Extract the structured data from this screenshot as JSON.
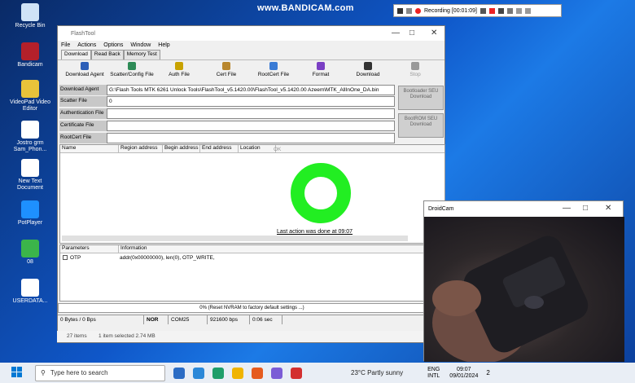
{
  "banner": "www.BANDICAM.com",
  "recorder": {
    "status": "Recording [00:01:09]"
  },
  "desktop_icons": [
    {
      "label": "Recycle Bin",
      "icon": "recycle-bin-icon",
      "color": "#cfe3f7"
    },
    {
      "label": "Bandicam",
      "icon": "bandicam-icon",
      "color": "#b4202a"
    },
    {
      "label": "VideoPad Video Editor",
      "icon": "videopad-icon",
      "color": "#e8c33a"
    },
    {
      "label": "Jostro grm Sam_Phon...",
      "icon": "file-icon",
      "color": "#ffffff"
    },
    {
      "label": "New Text Document",
      "icon": "text-file-icon",
      "color": "#ffffff"
    },
    {
      "label": "PotPlayer",
      "icon": "potplayer-icon",
      "color": "#1e90ff"
    },
    {
      "label": "08",
      "icon": "app-icon",
      "color": "#3bb54a"
    },
    {
      "label": "USERDATA...",
      "icon": "file-icon",
      "color": "#ffffff"
    }
  ],
  "app": {
    "title": "FlashTool",
    "menu": [
      "File",
      "Actions",
      "Options",
      "Window",
      "Help"
    ],
    "tabs": [
      "Download",
      "Read Back",
      "Memory Test"
    ],
    "toolbar": [
      {
        "label": "Download Agent",
        "icon": "download-agent-icon"
      },
      {
        "label": "Scatter/Config File",
        "icon": "scatter-file-icon"
      },
      {
        "label": "Auth File",
        "icon": "auth-file-icon"
      },
      {
        "label": "Cert File",
        "icon": "cert-file-icon"
      },
      {
        "label": "RootCert File",
        "icon": "rootcert-file-icon"
      },
      {
        "label": "Format",
        "icon": "format-icon"
      },
      {
        "label": "Download",
        "icon": "download-icon"
      },
      {
        "label": "Stop",
        "icon": "stop-icon"
      }
    ],
    "fields": [
      {
        "label": "Download Agent",
        "value": "G:\\Flash Tools MTK 6261 Unlock Tools\\FlashTool_v5.1420.00\\FlashTool_v5.1420.00  Azeem\\MTK_AllInOne_DA.bin"
      },
      {
        "label": "Scatter File",
        "value": "0"
      },
      {
        "label": "Authentication File",
        "value": ""
      },
      {
        "label": "Certificate File",
        "value": ""
      },
      {
        "label": "RootCert File",
        "value": ""
      }
    ],
    "side_buttons": [
      "Bootloader SEU Download",
      "BootROM SEU Download"
    ],
    "grid_columns": [
      "Name",
      "Region address",
      "Begin address",
      "End address",
      "Location"
    ],
    "ok_label": "OK",
    "last_action": "Last action was done at 09:07",
    "param_columns": [
      "Parameters",
      "Information"
    ],
    "param_row": {
      "name": "OTP",
      "info": "addr(0x00000000), len(0), OTP_WRITE,"
    },
    "progress_status": "0% (Reset NVRAM to factory default settings ...)",
    "status_bar": [
      "0 Bytes / 0 Bps",
      "NOR",
      "COM25",
      "921600 bps",
      "0:06 sec"
    ]
  },
  "explorer_status": {
    "items": "27 items",
    "selected": "1 item selected  2.74 MB"
  },
  "droidcam": {
    "title": "DroidCam"
  },
  "taskbar": {
    "search_placeholder": "Type here to search",
    "weather": "23°C  Partly sunny",
    "lang": "ENG",
    "lang2": "INTL",
    "time": "09:07",
    "date": "09/01/2024",
    "notif_count": "2"
  }
}
